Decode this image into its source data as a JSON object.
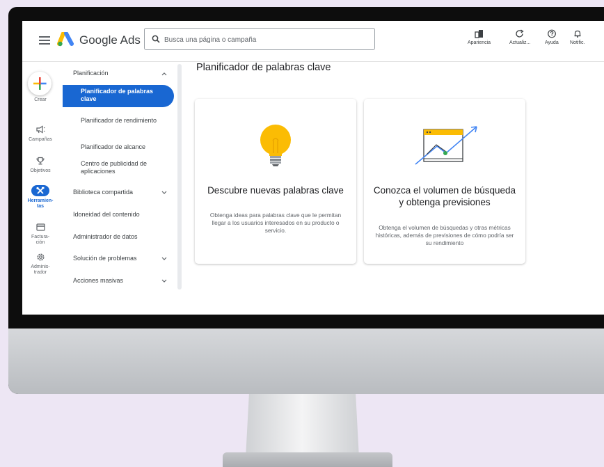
{
  "header": {
    "product_name": "Google Ads",
    "search_placeholder": "Busca una página o campaña",
    "tools": [
      {
        "label": "Apariencia",
        "icon": "appearance-icon"
      },
      {
        "label": "Actualiz...",
        "icon": "refresh-icon"
      },
      {
        "label": "Ayuda",
        "icon": "help-icon"
      },
      {
        "label": "Notific.",
        "icon": "bell-icon"
      }
    ]
  },
  "rail": {
    "create_label": "Crear",
    "items": [
      {
        "label": "Campañas",
        "icon": "megaphone-icon"
      },
      {
        "label": "Objetivos",
        "icon": "trophy-icon"
      },
      {
        "label": "Herramien-\ntas",
        "icon": "tools-icon",
        "active": true
      },
      {
        "label": "Factura-\nción",
        "icon": "billing-icon"
      },
      {
        "label": "Adminis-\ntrador",
        "icon": "admin-gear-icon"
      }
    ]
  },
  "sidenav": {
    "section_planning": "Planificación",
    "sub_items": [
      "Planificador de palabras clave",
      "Planificador de rendimiento",
      "Planificador de alcance",
      "Centro de publicidad de aplicaciones"
    ],
    "active_index": 0,
    "sections": [
      {
        "label": "Biblioteca compartida",
        "chevron": true
      },
      {
        "label": "Idoneidad del contenido",
        "chevron": false
      },
      {
        "label": "Administrador de datos",
        "chevron": false
      },
      {
        "label": "Solución de problemas",
        "chevron": true
      },
      {
        "label": "Acciones masivas",
        "chevron": true
      }
    ]
  },
  "main": {
    "page_title": "Planificador de palabras clave",
    "cards": [
      {
        "title": "Descubre nuevas palabras clave",
        "description": "Obtenga ideas para palabras clave que le permitan llegar a los usuarios interesados en su producto o servicio.",
        "icon": "lightbulb-icon"
      },
      {
        "title": "Conozca el volumen de búsqueda y obtenga previsiones",
        "description": "Obtenga el volumen de búsquedas y otras métricas históricas, además de previsiones de cómo podría ser su rendimiento",
        "icon": "forecast-chart-icon"
      }
    ]
  },
  "colors": {
    "accent": "#1967d2",
    "bulb": "#fbbc04",
    "page_bg": "#ede6f4"
  }
}
